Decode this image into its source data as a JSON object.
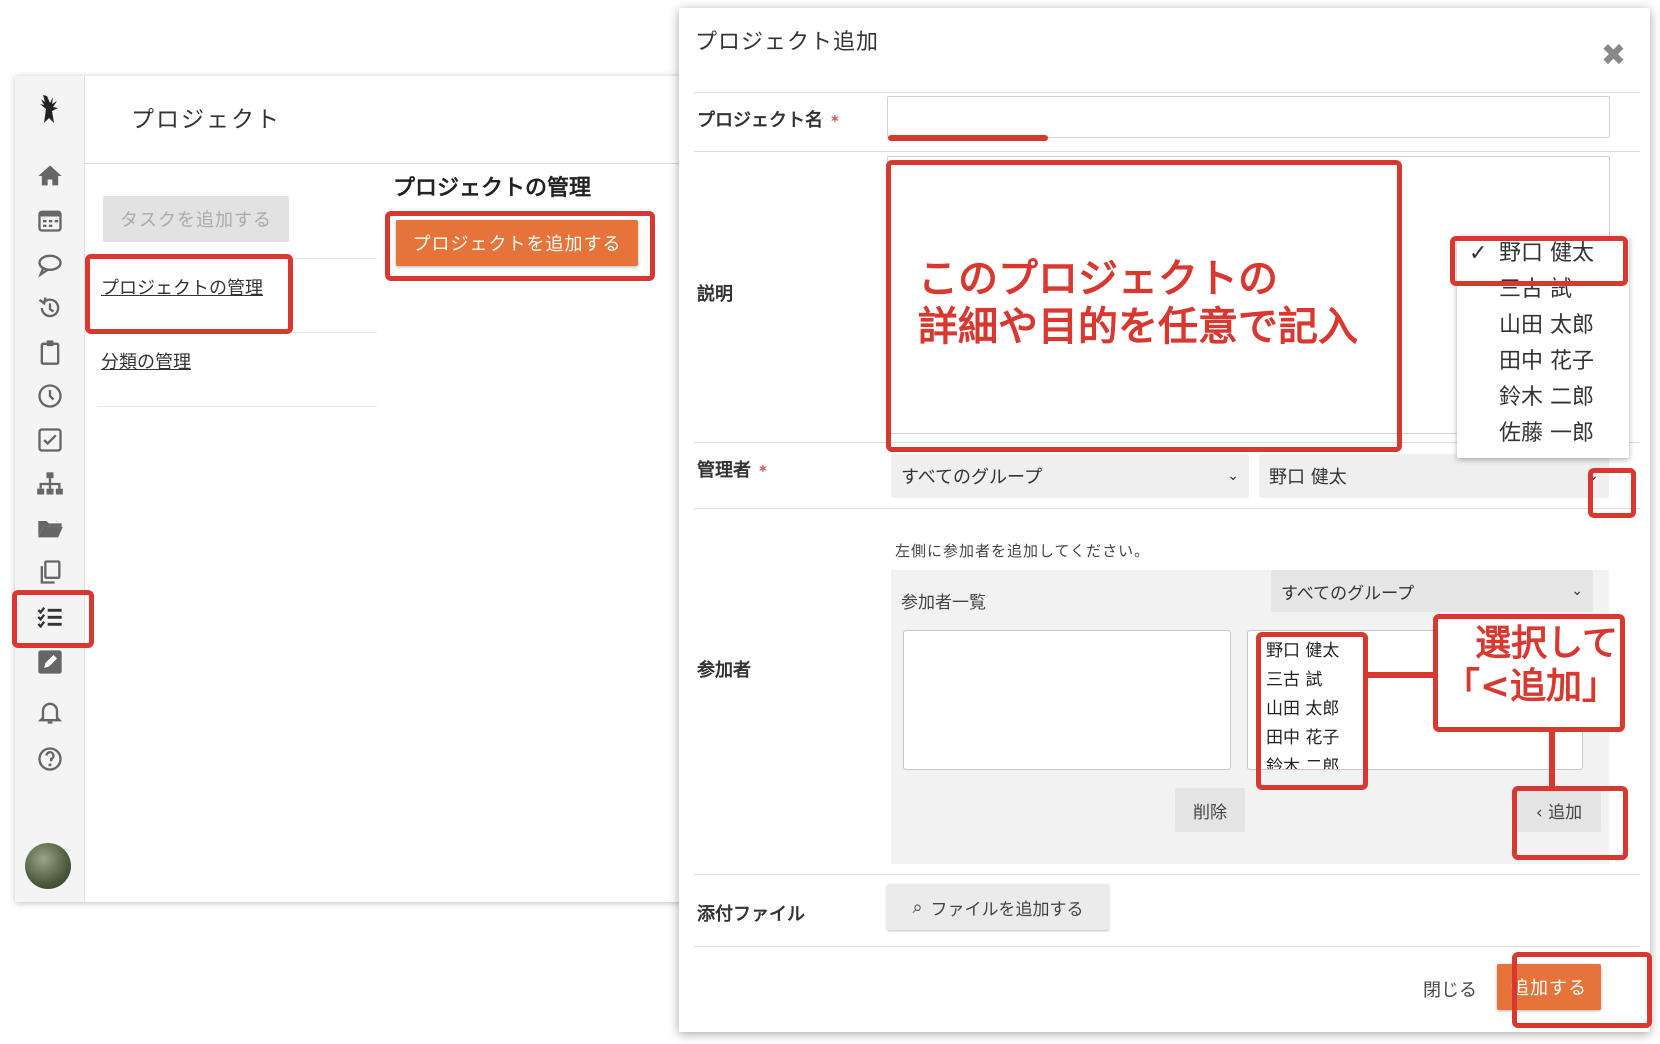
{
  "app": {
    "title": "プロジェクト",
    "side_button": "タスクを追加する",
    "side_links": [
      "プロジェクトの管理",
      "分類の管理"
    ],
    "content_title": "プロジェクトの管理",
    "add_project_button": "プロジェクトを追加する",
    "iconbar": [
      "home-icon",
      "calendar-icon",
      "chat-icon",
      "history-icon",
      "clipboard-icon",
      "clock-icon",
      "checkbox-icon",
      "org-chart-icon",
      "folder-icon",
      "copy-icon",
      "tasklist-icon",
      "edit-icon",
      "bell-icon",
      "help-icon"
    ]
  },
  "modal": {
    "title": "プロジェクト追加",
    "close": "✖",
    "fields": {
      "project_name": {
        "label": "プロジェクト名",
        "required": "*",
        "value": ""
      },
      "description": {
        "label": "説明",
        "value": ""
      },
      "manager": {
        "label": "管理者",
        "required": "*",
        "group_select": "すべてのグループ",
        "person_select": "野口 健太",
        "options": [
          "野口 健太",
          "三古 試",
          "山田 太郎",
          "田中 花子",
          "鈴木 二郎",
          "佐藤 一郎"
        ]
      },
      "participants": {
        "label": "参加者",
        "help": "左側に参加者を追加してください。",
        "list_label": "参加者一覧",
        "group_select": "すべてのグループ",
        "candidates": [
          "野口 健太",
          "三古 試",
          "山田 太郎",
          "田中 花子",
          "鈴木 二郎"
        ],
        "delete_button": "削除",
        "add_button": "‹ 追加"
      },
      "attachment": {
        "label": "添付ファイル",
        "button": "ファイルを追加する"
      }
    },
    "footer": {
      "close": "閉じる",
      "submit": "追加する"
    }
  },
  "annotations": {
    "description_note": "このプロジェクトの\n詳細や目的を任意で記入",
    "select_note": "選択して\n「<追加」"
  },
  "colors": {
    "accent": "#e6743a",
    "annotation": "#d8382f"
  }
}
